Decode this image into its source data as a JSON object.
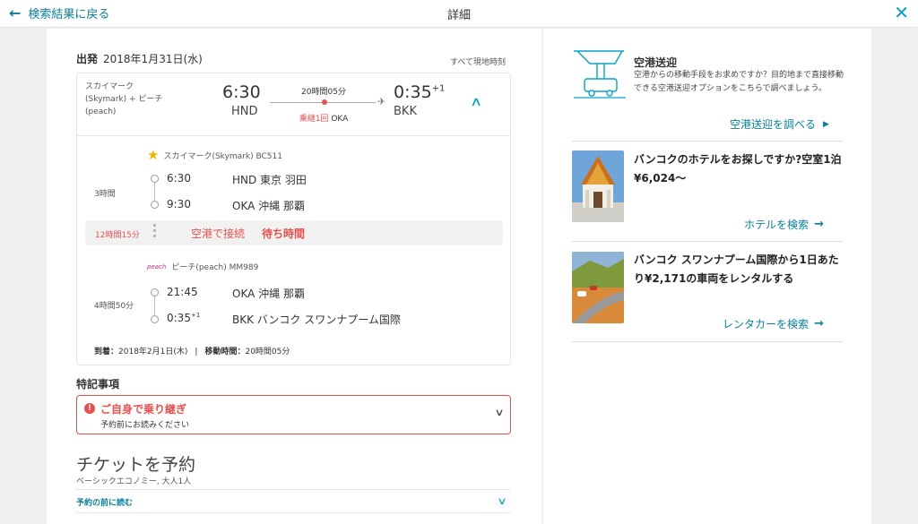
{
  "topbar": {
    "back_label": "検索結果に戻る",
    "title": "詳細"
  },
  "departure": {
    "label": "出発",
    "date": "2018年1月31日(水)",
    "local_time_note": "すべて現地時刻"
  },
  "summary": {
    "airlines": "スカイマーク(Skymark) + ピーチ(peach)",
    "dep_time": "6:30",
    "dep_code": "HND",
    "duration": "20時間05分",
    "stops_label": "乗継1回",
    "stop_code": "OKA",
    "arr_time": "0:35",
    "arr_day_offset": "+1",
    "arr_code": "BKK"
  },
  "segments": [
    {
      "airline": "スカイマーク(Skymark) BC511",
      "duration": "3時間",
      "dep_time": "6:30",
      "dep_place": "HND 東京 羽田",
      "arr_time": "9:30",
      "arr_day_offset": "",
      "arr_place": "OKA 沖縄 那覇"
    },
    {
      "logo_text": "peach",
      "airline": "ピーチ(peach) MM989",
      "duration": "4時間50分",
      "dep_time": "21:45",
      "dep_place": "OKA 沖縄 那覇",
      "arr_time": "0:35",
      "arr_day_offset": "+1",
      "arr_place": "BKK バンコク スワンナプーム国際"
    }
  ],
  "layover": {
    "duration": "12時間15分",
    "connect_label": "空港で接続",
    "wait_label": "待ち時間"
  },
  "footer": {
    "arrival_label": "到着：",
    "arrival_date": "2018年2月1日(木)",
    "travel_label": "移動時間：",
    "travel_time": "20時間05分"
  },
  "notes": {
    "title": "特記事項",
    "notice_title": "ご自身で乗り継ぎ",
    "notice_sub": "予約前にお読みください"
  },
  "booking": {
    "title": "チケットを予約",
    "subtitle": "ベーシックエコノミー, 大人1人",
    "read_before": "予約の前に読む"
  },
  "sidebar": {
    "transfer": {
      "title": "空港送迎",
      "desc": "空港からの移動手段をお求めですか？目的地まで直接移動できる空港送迎オプションをこちらで調べましょう。",
      "link": "空港送迎を調べる"
    },
    "hotel": {
      "text": "バンコクのホテルをお探しですか?空室1泊¥6,024〜",
      "link": "ホテルを検索"
    },
    "car": {
      "text": "バンコク スワンナプーム国際から1日あたり¥2,171の車両をレンタルする",
      "link": "レンタカーを検索"
    }
  },
  "colors": {
    "accent": "#0a7f9c",
    "alert": "#e4514f",
    "icon_teal": "#0aa0c8"
  },
  "icons": {
    "back": "arrow-left-icon",
    "close": "close-icon",
    "plane": "plane-icon"
  }
}
